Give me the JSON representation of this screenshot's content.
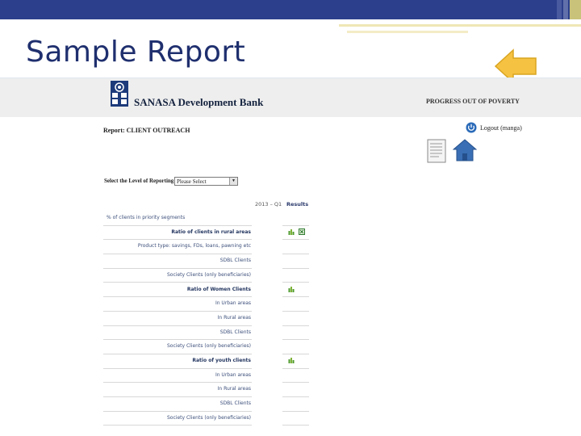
{
  "slide": {
    "title": "Sample Report"
  },
  "header": {
    "bank_name": "SANASA Development Bank",
    "tagline": "PROGRESS OUT OF POVERTY"
  },
  "report": {
    "label": "Report: CLIENT OUTREACH",
    "logout_label": "Logout (manga)",
    "level_label": "Select the Level of Reporting",
    "level_value": "Please Select",
    "period_header": "2013 – Q1",
    "results_header": "Results"
  },
  "table": {
    "rows": [
      {
        "label": "% of clients in priority segments",
        "style": "left",
        "icons": []
      },
      {
        "label": "Ratio of clients in rural areas",
        "style": "bold",
        "icons": [
          "chart",
          "excel"
        ]
      },
      {
        "label": "Product type: savings, FDs, loans, pawning etc",
        "style": "normal",
        "icons": []
      },
      {
        "label": "SDBL Clients",
        "style": "normal",
        "icons": []
      },
      {
        "label": "Society Clients (only beneficiaries)",
        "style": "normal",
        "icons": []
      },
      {
        "label": "Ratio of Women Clients",
        "style": "bold",
        "icons": [
          "chart"
        ]
      },
      {
        "label": "In Urban areas",
        "style": "normal",
        "icons": []
      },
      {
        "label": "In Rural areas",
        "style": "normal",
        "icons": []
      },
      {
        "label": "SDBL Clients",
        "style": "normal",
        "icons": []
      },
      {
        "label": "Society Clients (only beneficiaries)",
        "style": "normal",
        "icons": []
      },
      {
        "label": "Ratio of youth clients",
        "style": "bold",
        "icons": [
          "chart"
        ]
      },
      {
        "label": "In Urban areas",
        "style": "normal",
        "icons": []
      },
      {
        "label": "In Rural areas",
        "style": "normal",
        "icons": []
      },
      {
        "label": "SDBL Clients",
        "style": "normal",
        "icons": []
      },
      {
        "label": "Society Clients (only beneficiaries)",
        "style": "normal",
        "icons": []
      }
    ]
  },
  "icons": {
    "back": "back-arrow-icon",
    "logo": "sdbl-logo",
    "logout": "power-icon",
    "doc": "document-icon",
    "home": "home-icon",
    "chart": "chart-icon",
    "excel": "excel-icon"
  },
  "colors": {
    "title": "#1f2f6e",
    "band": "#2b3f8c",
    "arrow": "#f6c242",
    "home": "#3a6fb5"
  }
}
